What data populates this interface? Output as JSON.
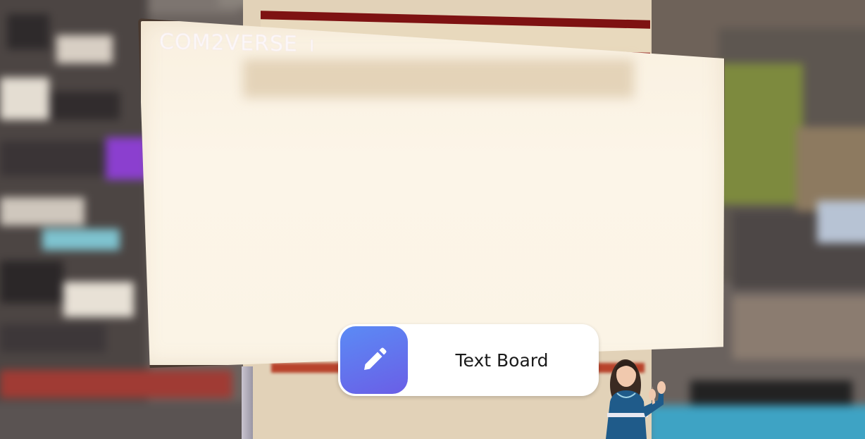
{
  "scene": {
    "brand_logo_text": "COM2VERSE",
    "brand_logo_suffix": "I"
  },
  "text_board_button": {
    "label": "Text Board",
    "icon": "pencil-icon"
  },
  "colors": {
    "button_gradient_start": "#5b8bf5",
    "button_gradient_end": "#6a5ee6",
    "board_surface": "#fbf4e6",
    "board_trim": "#7e1212"
  }
}
